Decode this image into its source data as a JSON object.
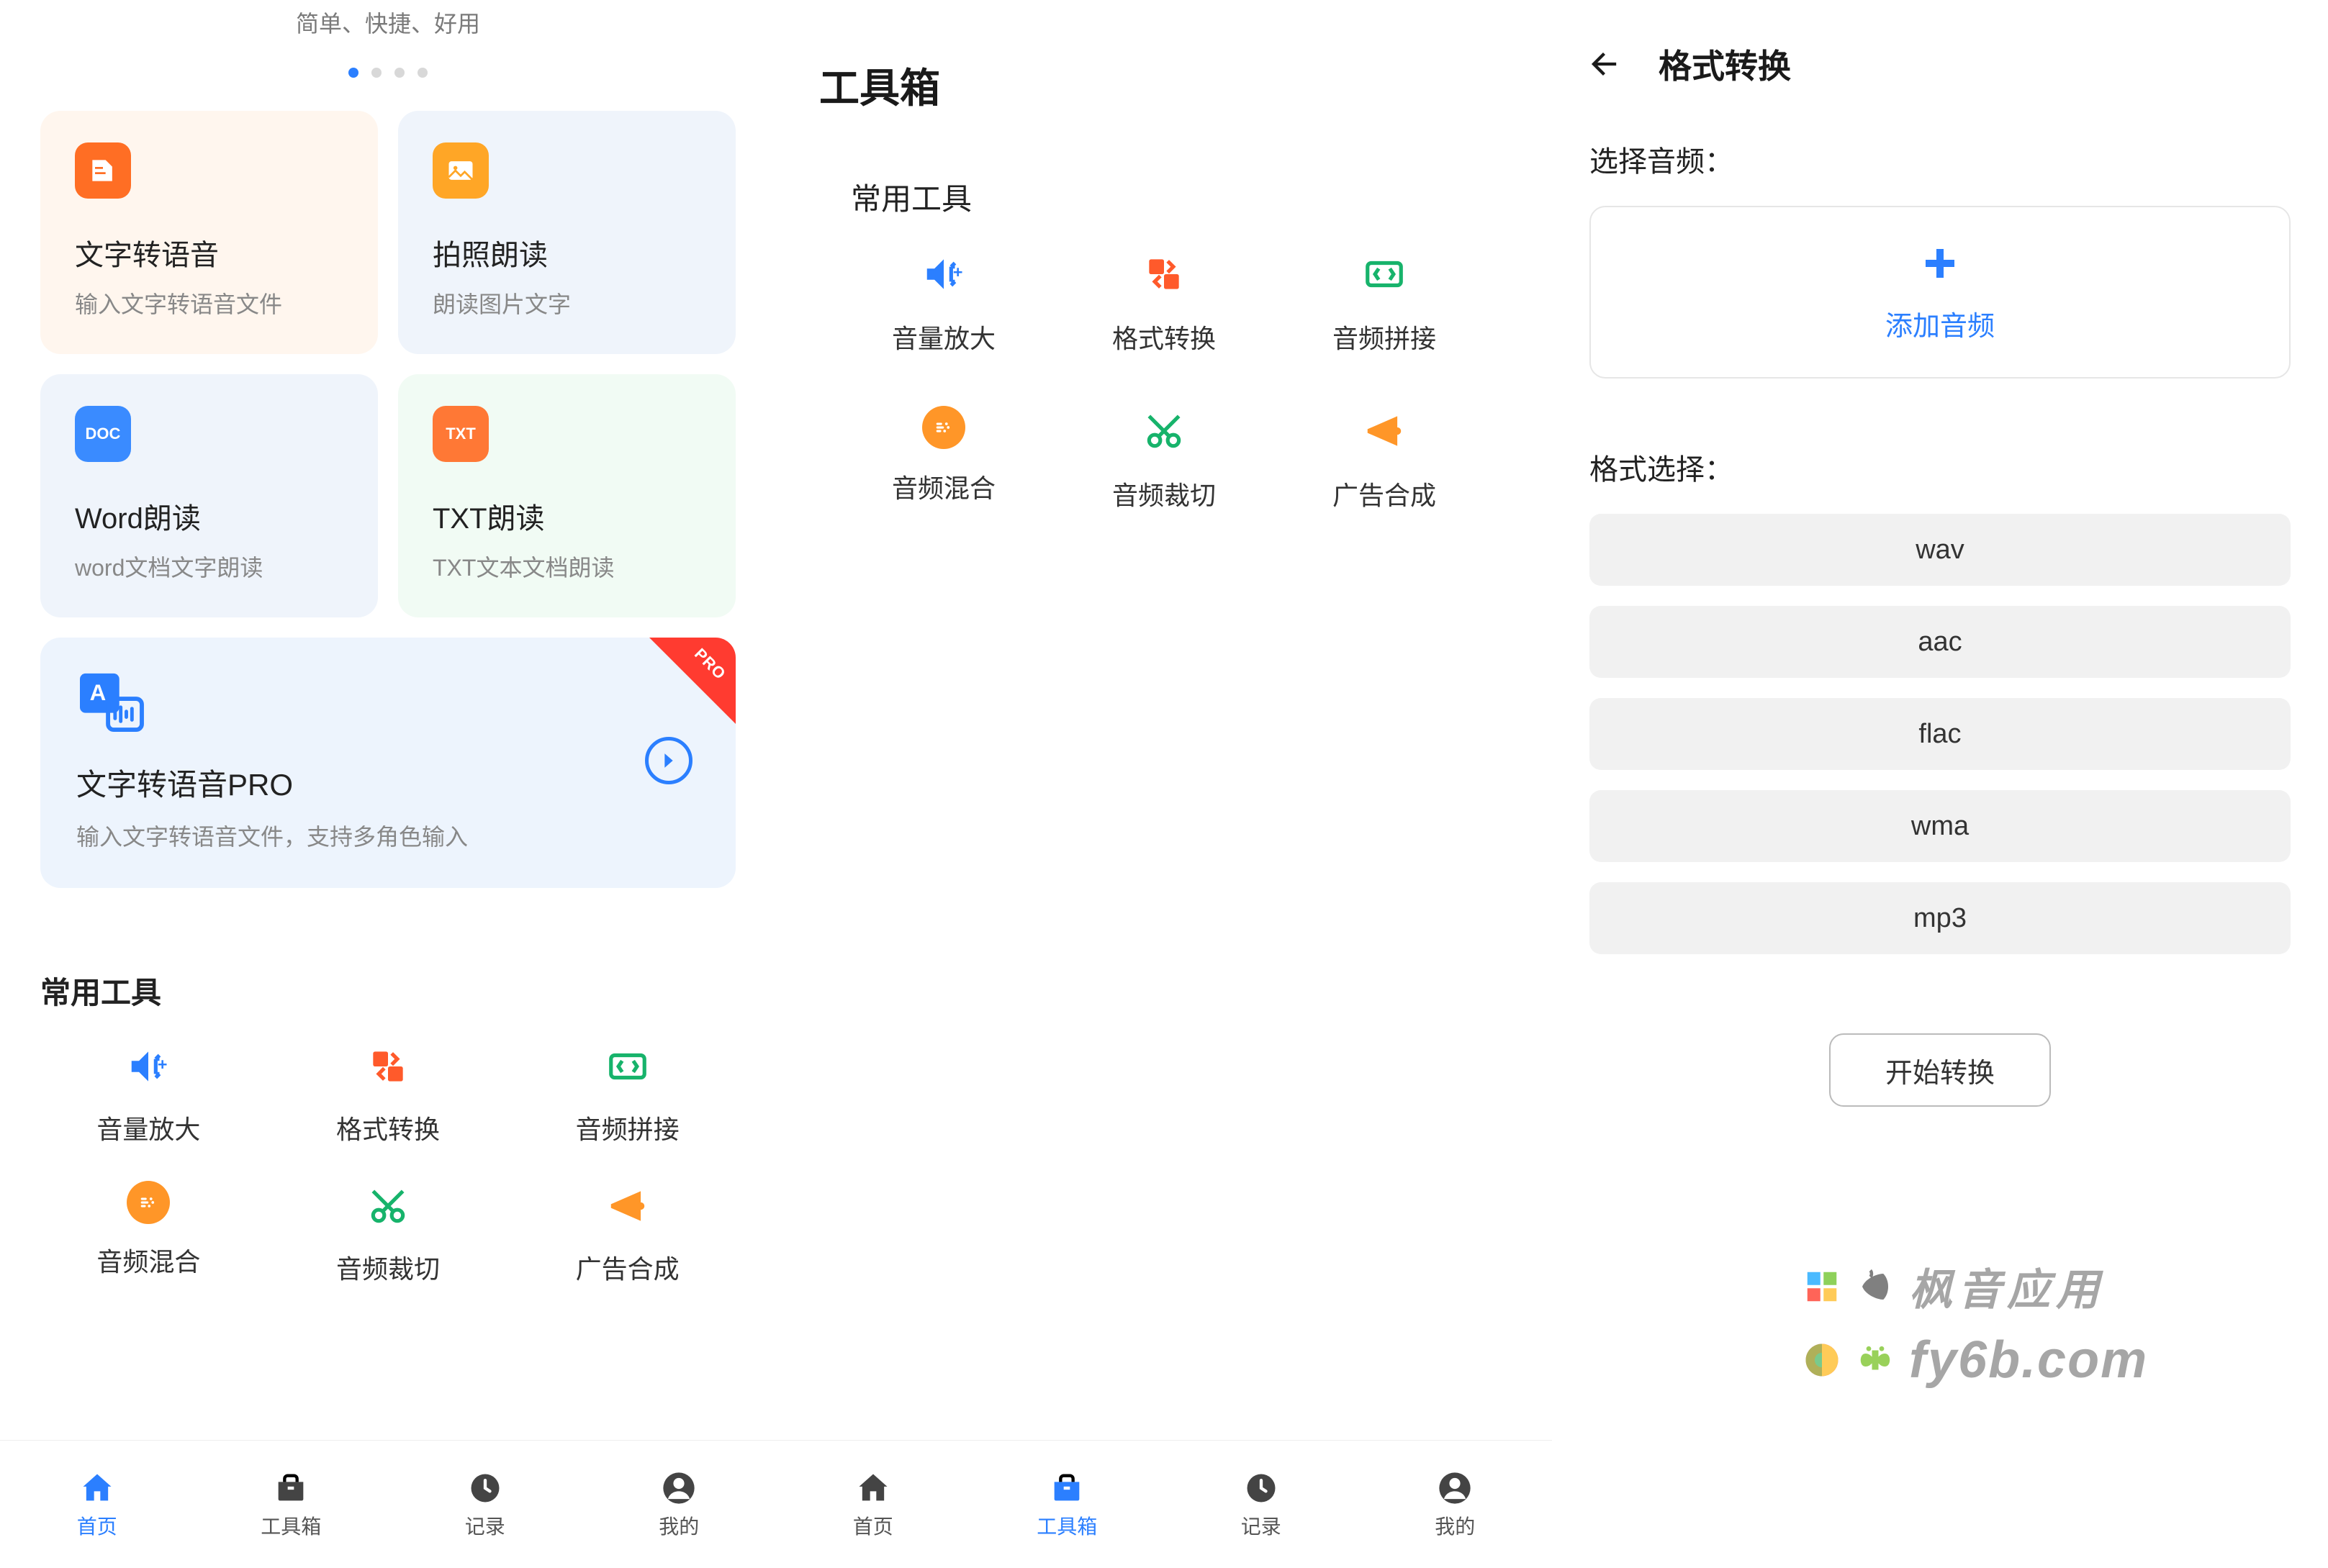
{
  "colors": {
    "primary": "#2b7fff",
    "orange": "#ff6e24",
    "yellow": "#ffa626"
  },
  "s1": {
    "tagline": "简单、快捷、好用",
    "cards": [
      {
        "title": "文字转语音",
        "sub": "输入文字转语音文件"
      },
      {
        "title": "拍照朗读",
        "sub": "朗读图片文字"
      },
      {
        "title": "Word朗读",
        "sub": "word文档文字朗读"
      },
      {
        "title": "TXT朗读",
        "sub": "TXT文本文档朗读"
      }
    ],
    "pro": {
      "title": "文字转语音PRO",
      "sub": "输入文字转语音文件，支持多角色输入",
      "tag": "PRO"
    },
    "tools_title": "常用工具"
  },
  "s2": {
    "title": "工具箱",
    "section": "常用工具"
  },
  "tools": [
    {
      "name": "音量放大"
    },
    {
      "name": "格式转换"
    },
    {
      "name": "音频拼接"
    },
    {
      "name": "音频混合"
    },
    {
      "name": "音频裁切"
    },
    {
      "name": "广告合成"
    }
  ],
  "nav": [
    {
      "label": "首页"
    },
    {
      "label": "工具箱"
    },
    {
      "label": "记录"
    },
    {
      "label": "我的"
    }
  ],
  "s3": {
    "title": "格式转换",
    "select_audio": "选择音频：",
    "add_audio": "添加音频",
    "format_select": "格式选择：",
    "formats": [
      "wav",
      "aac",
      "flac",
      "wma",
      "mp3"
    ],
    "convert": "开始转换"
  },
  "watermark": {
    "line1": "枫音应用",
    "line2": "fy6b.com"
  },
  "icon_labels": {
    "doc": "DOC",
    "txt": "TXT"
  }
}
